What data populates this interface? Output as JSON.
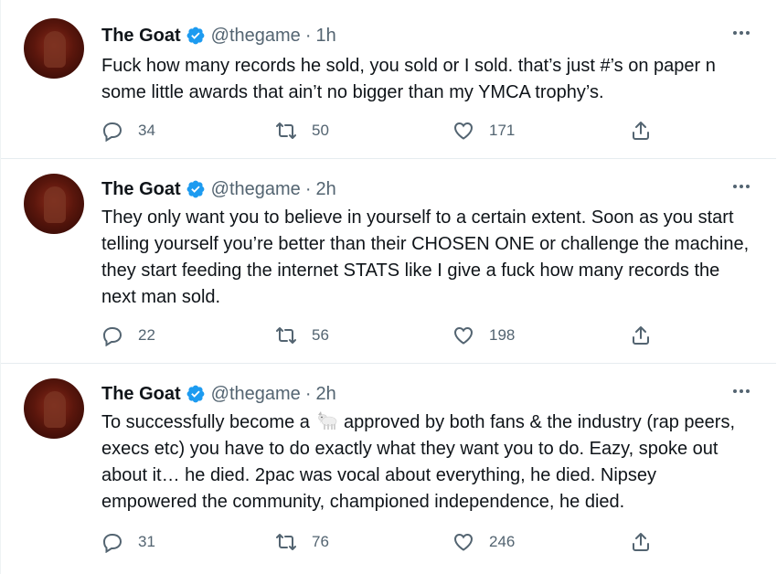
{
  "tweets": [
    {
      "name": "The Goat",
      "handle": "@thegame",
      "dot": "·",
      "time": "1h",
      "text_before": "Fuck how many records he sold, you sold or I sold. that’s just #’s on paper n some little awards that ain’t no bigger than my YMCA trophy’s.",
      "text_after": "",
      "replies": "34",
      "retweets": "50",
      "likes": "171"
    },
    {
      "name": "The Goat",
      "handle": "@thegame",
      "dot": "·",
      "time": "2h",
      "text_before": "They only want you to believe in yourself to a certain extent. Soon as you start telling yourself you’re better than their CHOSEN ONE or challenge the machine, they start feeding the internet STATS like I give a fuck how many records the next man sold.",
      "text_after": "",
      "replies": "22",
      "retweets": "56",
      "likes": "198"
    },
    {
      "name": "The Goat",
      "handle": "@thegame",
      "dot": "·",
      "time": "2h",
      "text_before": "To successfully become a ",
      "emoji": "goat-emoji",
      "text_after": " approved by both fans & the industry (rap peers, execs etc) you have to do exactly what they want you to do. Eazy, spoke out about it… he died. 2pac was vocal about everything, he died. Nipsey empowered the community, championed independence, he died.",
      "replies": "31",
      "retweets": "76",
      "likes": "246"
    }
  ],
  "icons": {
    "verified": "verified-badge-icon",
    "more": "more-options-icon",
    "reply": "reply-icon",
    "retweet": "retweet-icon",
    "like": "like-icon",
    "share": "share-icon"
  },
  "colors": {
    "verified_blue": "#1d9bf0",
    "secondary_text": "#536471",
    "divider": "#e6ecf0"
  }
}
